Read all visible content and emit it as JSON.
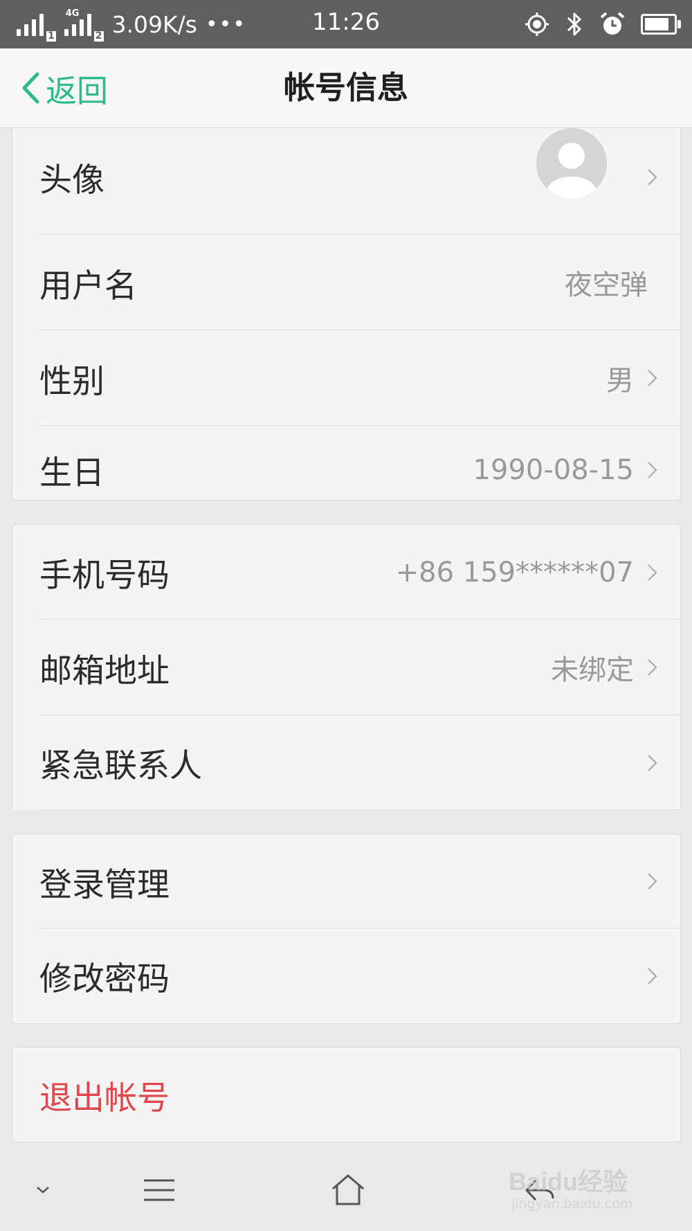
{
  "status_bar": {
    "sim1_label": "1",
    "sim2_label": "2",
    "network": "4G",
    "speed": "3.09K/s",
    "overflow_dots": "•••",
    "time": "11:26",
    "battery_level": 0.85,
    "icons": [
      "location-icon",
      "bluetooth-icon",
      "alarm-icon",
      "battery-icon"
    ]
  },
  "nav": {
    "back_label": "返回",
    "title": "帐号信息"
  },
  "profile": {
    "avatar_label": "头像",
    "username_label": "用户名",
    "username_value": "夜空弹",
    "gender_label": "性别",
    "gender_value": "男",
    "birthday_label": "生日",
    "birthday_value": "1990-08-15"
  },
  "contact": {
    "phone_label": "手机号码",
    "phone_value": "+86 159******07",
    "email_label": "邮箱地址",
    "email_value": "未绑定",
    "emergency_label": "紧急联系人"
  },
  "security": {
    "login_label": "登录管理",
    "password_label": "修改密码"
  },
  "logout": {
    "label": "退出帐号"
  },
  "watermark": {
    "brand": "Baidu经验",
    "url": "jingyan.baidu.com"
  },
  "colors": {
    "accent": "#2bbb8a",
    "danger": "#e0474d",
    "status_bar": "#5f5f5f",
    "secondary_text": "#999999"
  }
}
